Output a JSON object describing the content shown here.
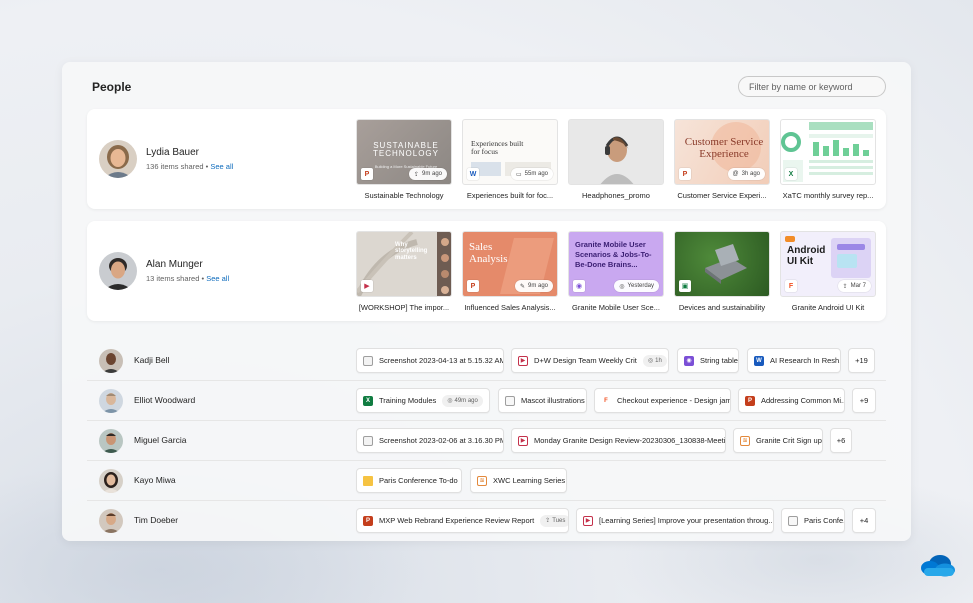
{
  "page": {
    "title": "People"
  },
  "filter": {
    "placeholder": "Filter by name or keyword"
  },
  "featured_people": [
    {
      "name": "Lydia Bauer",
      "items_shared": "136 items shared",
      "separator": "•",
      "see_all": "See all",
      "files": [
        {
          "caption": "Sustainable Technology",
          "thumb_title": "SUSTAINABLE TECHNOLOGY",
          "thumb_sub": "Building a More Sustainable Future",
          "badge": "9m ago",
          "icon": "ppt"
        },
        {
          "caption": "Experiences built for foc...",
          "thumb_title": "Experiences built for focus",
          "badge": "55m ago",
          "icon": "word"
        },
        {
          "caption": "Headphones_promo",
          "icon": "image"
        },
        {
          "caption": "Customer Service Experi...",
          "thumb_title": "Customer Service Experience",
          "badge": "3h ago",
          "icon": "ppt"
        },
        {
          "caption": "XaTC monthly survey rep...",
          "icon": "excel"
        }
      ]
    },
    {
      "name": "Alan Munger",
      "items_shared": "13 items shared",
      "separator": "•",
      "see_all": "See all",
      "files": [
        {
          "caption": "[WORKSHOP] The impor...",
          "thumb_title": "Why storytelling matters",
          "icon": "video"
        },
        {
          "caption": "Influenced Sales Analysis...",
          "thumb_title": "Sales Analysis",
          "badge": "9m ago",
          "icon": "ppt"
        },
        {
          "caption": "Granite Mobile User Sce...",
          "thumb_title": "Granite Mobile User Scenarios & Jobs-To-Be-Done Brains...",
          "badge": "Yesterday",
          "icon": "loop"
        },
        {
          "caption": "Devices and sustainability",
          "icon": "image"
        },
        {
          "caption": "Granite Android UI Kit",
          "thumb_title": "Android UI Kit",
          "badge": "Mar 7",
          "icon": "figma"
        }
      ]
    }
  ],
  "people": [
    {
      "name": "Kadji Bell",
      "files": [
        {
          "label": "Screenshot 2023-04-13 at 5.15.32 AM",
          "icon": "image"
        },
        {
          "label": "D+W Design Team Weekly Crit",
          "icon": "video",
          "badge": "1h"
        },
        {
          "label": "String table",
          "icon": "loop"
        },
        {
          "label": "AI Research In Resh...",
          "icon": "word"
        }
      ],
      "more": "+19"
    },
    {
      "name": "Elliot Woodward",
      "files": [
        {
          "label": "Training Modules",
          "icon": "excel",
          "badge": "49m ago"
        },
        {
          "label": "Mascot illustrations",
          "icon": "pdf"
        },
        {
          "label": "Checkout experience - Design jam",
          "icon": "figma"
        },
        {
          "label": "Addressing Common Mi...",
          "icon": "ppt"
        }
      ],
      "more": "+9"
    },
    {
      "name": "Miguel Garcia",
      "files": [
        {
          "label": "Screenshot 2023-02-06 at 3.16.30 PM",
          "icon": "image"
        },
        {
          "label": "Monday Granite Design Review-20230306_130838-Meeti...",
          "icon": "video"
        },
        {
          "label": "Granite Crit Sign up",
          "icon": "xwc"
        }
      ],
      "more": "+6"
    },
    {
      "name": "Kayo Miwa",
      "files": [
        {
          "label": "Paris Conference To-do",
          "icon": "folder"
        },
        {
          "label": "XWC Learning Series",
          "icon": "xwc"
        }
      ]
    },
    {
      "name": "Tim Doeber",
      "files": [
        {
          "label": "MXP Web Rebrand Experience Review Report",
          "icon": "ppt",
          "badge": "Tues"
        },
        {
          "label": "[Learning Series] Improve your presentation throug...",
          "icon": "video"
        },
        {
          "label": "Paris Confe...",
          "icon": "pdf"
        }
      ],
      "more": "+4"
    }
  ],
  "colors": {
    "accent": "#0f6cbd",
    "ppt": "#c43e1c",
    "word": "#185abd",
    "excel": "#107c41",
    "loop": "#7b4fd6",
    "onedrive": "#0364b8"
  }
}
